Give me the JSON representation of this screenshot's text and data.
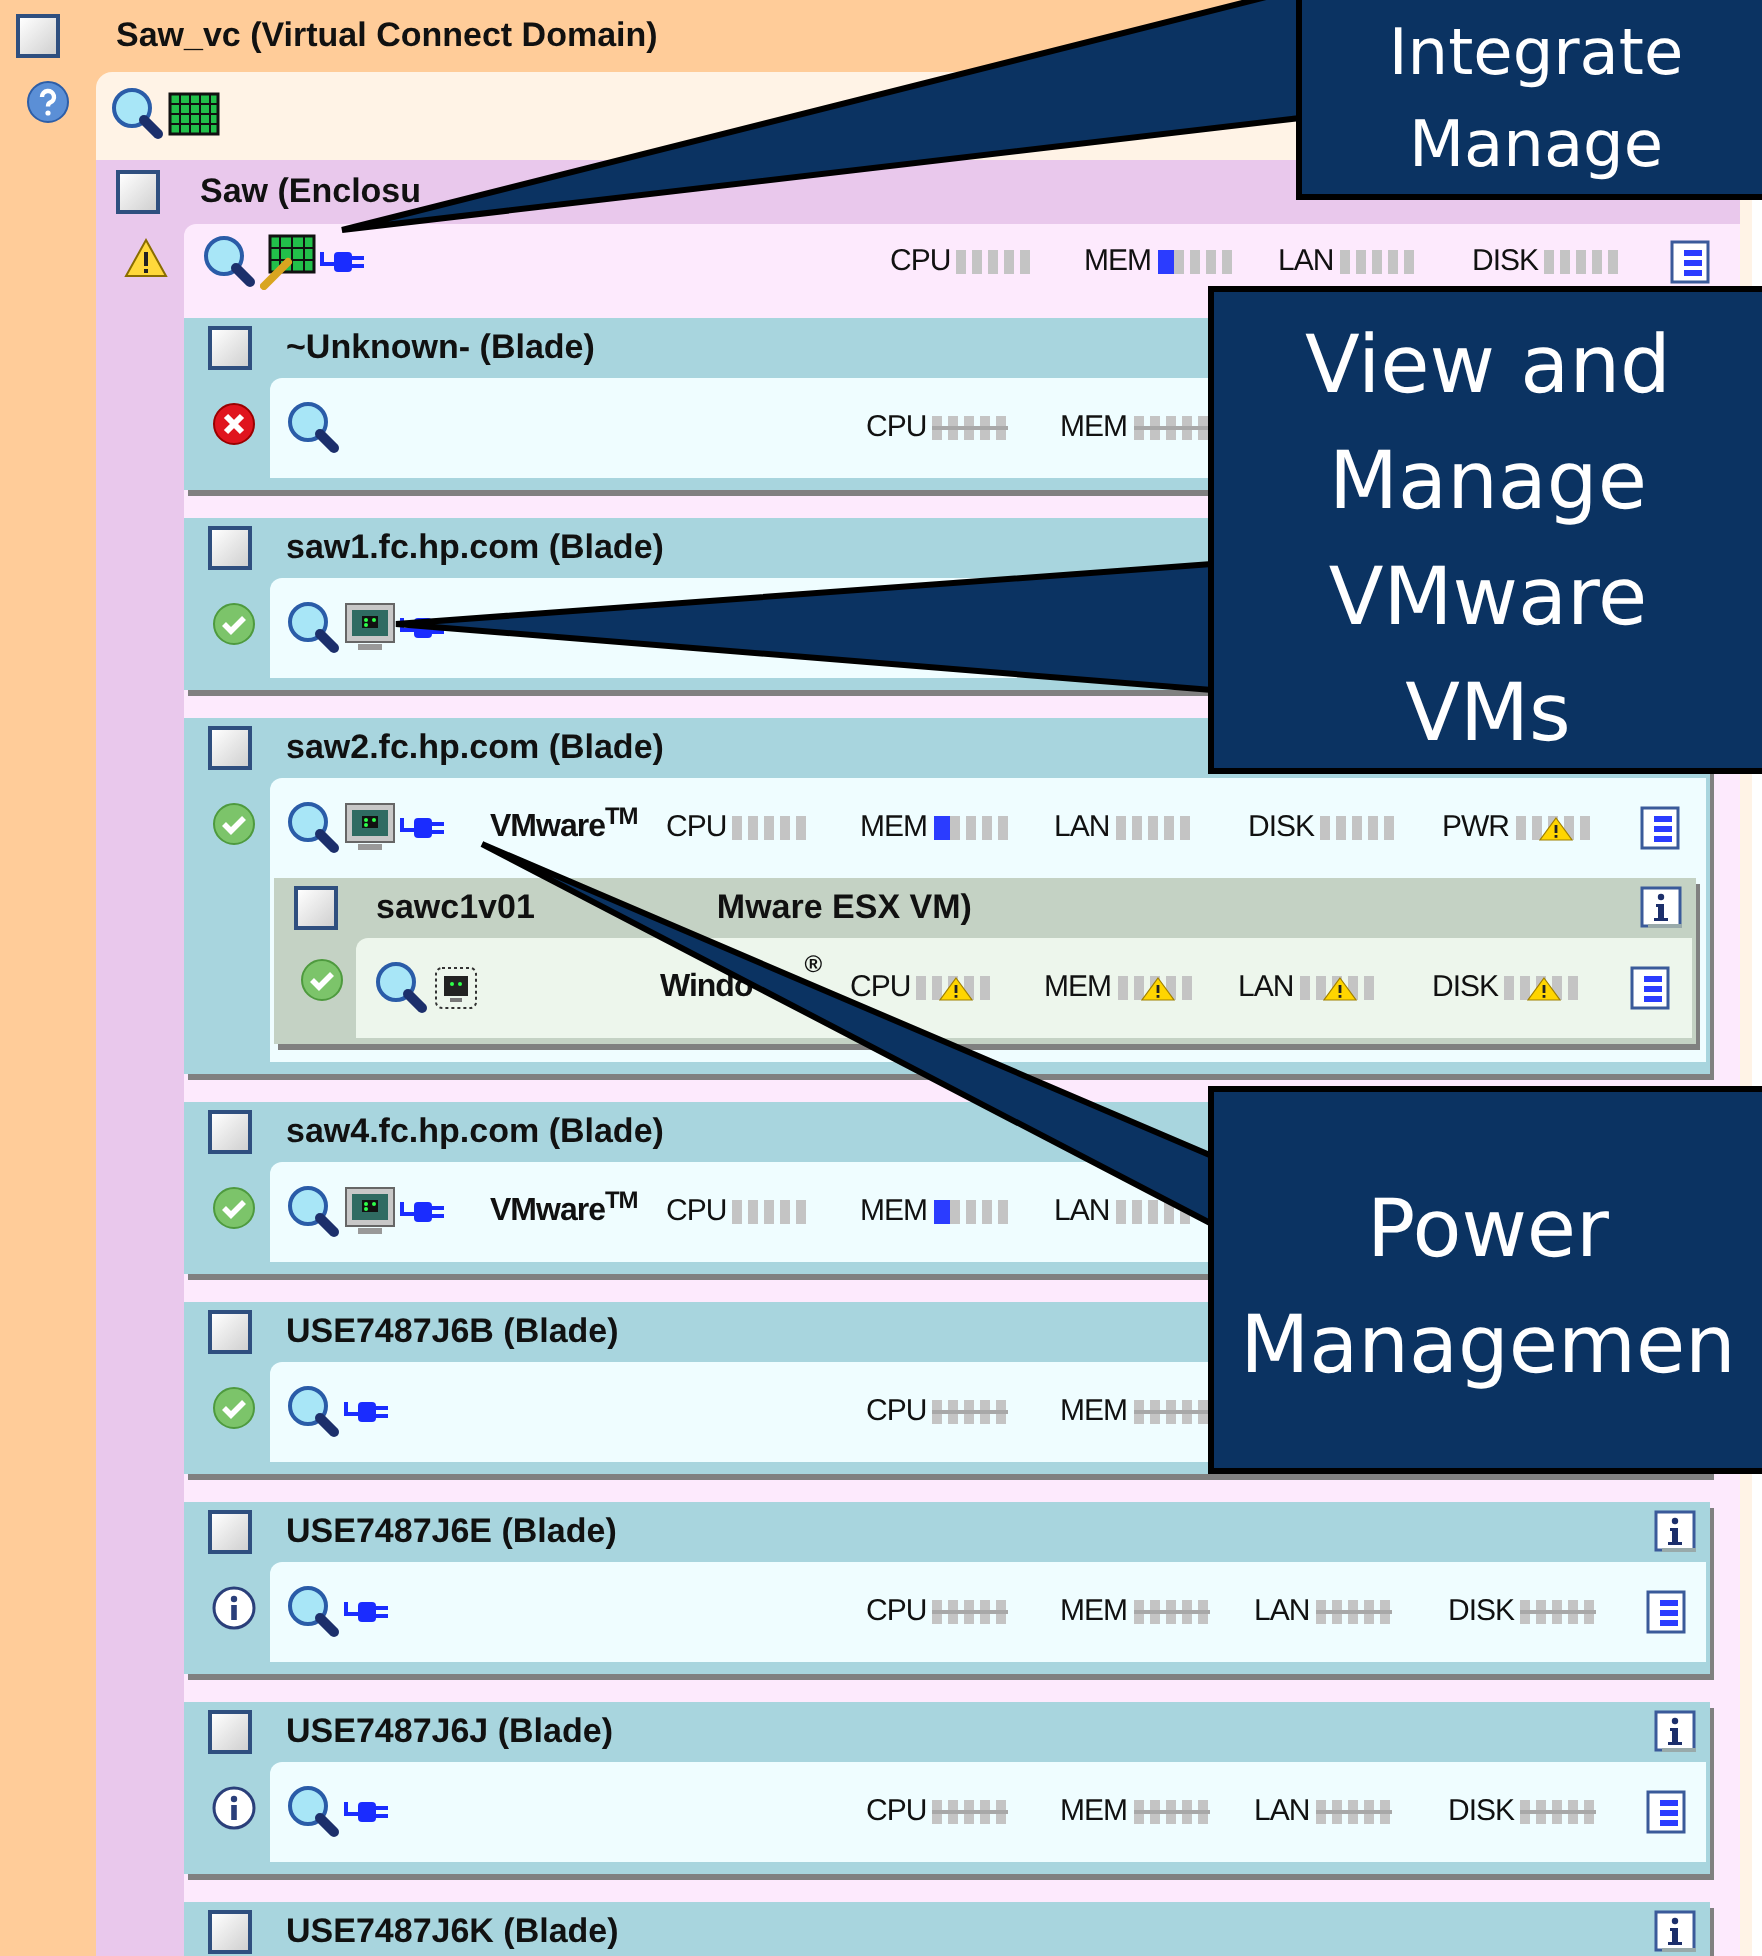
{
  "domain": {
    "kind": "domain",
    "title": "Saw_vc (Virtual Connect Domain)",
    "checked": false,
    "status": {
      "kind": "help"
    },
    "icons": [
      {
        "kind": "magnifier"
      },
      {
        "kind": "grid"
      }
    ],
    "children": [
      {
        "kind": "enclosure",
        "title": "Saw (Enclosu",
        "checked": false,
        "status": {
          "kind": "warning"
        },
        "icons": [
          {
            "kind": "magnifier"
          },
          {
            "kind": "grid-wrench"
          },
          {
            "kind": "plug"
          }
        ],
        "report_icon": true,
        "meters": [
          {
            "label": "CPU",
            "kind": "normal"
          },
          {
            "label": "MEM",
            "kind": "normal",
            "level": 0.2
          },
          {
            "label": "LAN",
            "kind": "normal"
          },
          {
            "label": "DISK",
            "kind": "normal"
          }
        ],
        "children": [
          {
            "kind": "blade",
            "title": "~Unknown- (Blade)",
            "checked": false,
            "status": {
              "kind": "error"
            },
            "icons": [
              {
                "kind": "magnifier"
              }
            ],
            "meters": [
              {
                "label": "CPU",
                "kind": "unknown"
              },
              {
                "label": "MEM",
                "kind": "unknown"
              }
            ]
          },
          {
            "kind": "blade",
            "title": "saw1.fc.hp.com (Blade)",
            "checked": false,
            "status": {
              "kind": "ok"
            },
            "icons": [
              {
                "kind": "magnifier"
              },
              {
                "kind": "monitor"
              },
              {
                "kind": "plug"
              }
            ]
          },
          {
            "kind": "blade",
            "title": "saw2.fc.hp.com (Blade)",
            "checked": false,
            "status": {
              "kind": "ok"
            },
            "icons": [
              {
                "kind": "magnifier"
              },
              {
                "kind": "monitor"
              },
              {
                "kind": "plug"
              }
            ],
            "vendor": "VMware$^{TM}$",
            "report_icon": true,
            "meters": [
              {
                "label": "CPU",
                "kind": "normal"
              },
              {
                "label": "MEM",
                "kind": "normal",
                "level": 0.2
              },
              {
                "label": "LAN",
                "kind": "normal"
              },
              {
                "label": "DISK",
                "kind": "normal"
              },
              {
                "label": "PWR",
                "kind": "warning"
              }
            ],
            "children": [
              {
                "kind": "vm",
                "title": "sawc1v01",
                "title_tail": "Mware ESX VM)",
                "checked": false,
                "status": {
                  "kind": "ok"
                },
                "info_icon": true,
                "icons": [
                  {
                    "kind": "magnifier"
                  },
                  {
                    "kind": "vm-monitor"
                  }
                ],
                "vendor": "Windo",
                "vendor_mark": "®",
                "report_icon": true,
                "meters": [
                  {
                    "label": "CPU",
                    "kind": "warning"
                  },
                  {
                    "label": "MEM",
                    "kind": "warning"
                  },
                  {
                    "label": "LAN",
                    "kind": "warning"
                  },
                  {
                    "label": "DISK",
                    "kind": "warning"
                  }
                ]
              }
            ]
          },
          {
            "kind": "blade",
            "title": "saw4.fc.hp.com (Blade)",
            "checked": false,
            "status": {
              "kind": "ok"
            },
            "icons": [
              {
                "kind": "magnifier"
              },
              {
                "kind": "monitor"
              },
              {
                "kind": "plug"
              }
            ],
            "vendor": "VMware$^{TM}$",
            "meters": [
              {
                "label": "CPU",
                "kind": "normal"
              },
              {
                "label": "MEM",
                "kind": "normal",
                "level": 0.2
              },
              {
                "label": "LAN",
                "kind": "normal"
              }
            ]
          },
          {
            "kind": "blade",
            "title": "USE7487J6B (Blade)",
            "checked": false,
            "status": {
              "kind": "ok"
            },
            "icons": [
              {
                "kind": "magnifier"
              },
              {
                "kind": "plug"
              }
            ],
            "meters": [
              {
                "label": "CPU",
                "kind": "unknown"
              },
              {
                "label": "MEM",
                "kind": "unknown"
              }
            ]
          },
          {
            "kind": "blade",
            "title": "USE7487J6E (Blade)",
            "checked": false,
            "status": {
              "kind": "info"
            },
            "info_icon": true,
            "icons": [
              {
                "kind": "magnifier"
              },
              {
                "kind": "plug"
              }
            ],
            "report_icon": true,
            "meters": [
              {
                "label": "CPU",
                "kind": "unknown"
              },
              {
                "label": "MEM",
                "kind": "unknown"
              },
              {
                "label": "LAN",
                "kind": "unknown"
              },
              {
                "label": "DISK",
                "kind": "unknown"
              }
            ]
          },
          {
            "kind": "blade",
            "title": "USE7487J6J (Blade)",
            "checked": false,
            "status": {
              "kind": "info"
            },
            "info_icon": true,
            "icons": [
              {
                "kind": "magnifier"
              },
              {
                "kind": "plug"
              }
            ],
            "report_icon": true,
            "meters": [
              {
                "label": "CPU",
                "kind": "unknown"
              },
              {
                "label": "MEM",
                "kind": "unknown"
              },
              {
                "label": "LAN",
                "kind": "unknown"
              },
              {
                "label": "DISK",
                "kind": "unknown"
              }
            ]
          },
          {
            "kind": "blade",
            "title": "USE7487J6K (Blade)",
            "checked": false,
            "info_icon": true
          }
        ]
      }
    ]
  },
  "callouts": [
    {
      "lines": [
        "Integrate",
        "Manage"
      ]
    },
    {
      "lines": [
        "View and",
        "Manage",
        "VMware",
        "VMs"
      ]
    },
    {
      "lines": [
        "Power",
        "Managemen"
      ]
    }
  ]
}
